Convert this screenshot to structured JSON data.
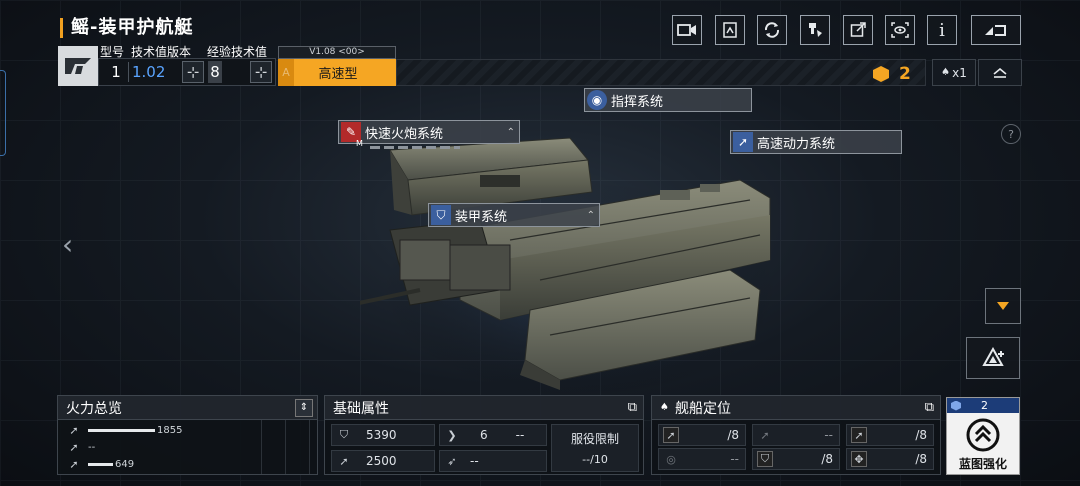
{
  "header": {
    "title": "鳐-装甲护航艇",
    "top_icons": [
      "camera-icon",
      "share-list-icon",
      "refresh-icon",
      "paint-icon",
      "export-icon",
      "scan-icon",
      "info-icon",
      "back-icon"
    ],
    "info_icon_text": "i"
  },
  "info": {
    "model_label": "型号",
    "model_value": "1",
    "tech_version_label": "技术值版本",
    "tech_version_value": "1.02",
    "exp_tech_label": "经验技术值",
    "exp_tech_value": "8",
    "version": "V1.08 <00>",
    "mode_grade": "A",
    "mode_name": "高速型",
    "resource_count": "2",
    "fleet_text": "x1"
  },
  "systems": {
    "fire": "快速火炮系统",
    "fire_tag": "M",
    "command": "指挥系统",
    "armor": "装甲系统",
    "power": "高速动力系统"
  },
  "help_text": "?",
  "bottom": {
    "firepower": {
      "title": "火力总览",
      "rows": [
        {
          "value": "1855",
          "fill": 0.95
        },
        {
          "value": "--",
          "fill": 0
        },
        {
          "value": "649",
          "fill": 0.35
        }
      ]
    },
    "base": {
      "title": "基础属性",
      "armor": "5390",
      "speed": "2500",
      "dodge": "6",
      "dodge_extra": "--",
      "spare": "--",
      "service_label": "服役限制",
      "service_value": "--/10"
    },
    "positioning": {
      "title": "舰船定位",
      "cells": [
        "/8",
        "--",
        "/8",
        "--",
        "/8",
        "/8"
      ]
    },
    "blueprint": {
      "count": "2",
      "label": "蓝图强化"
    }
  }
}
